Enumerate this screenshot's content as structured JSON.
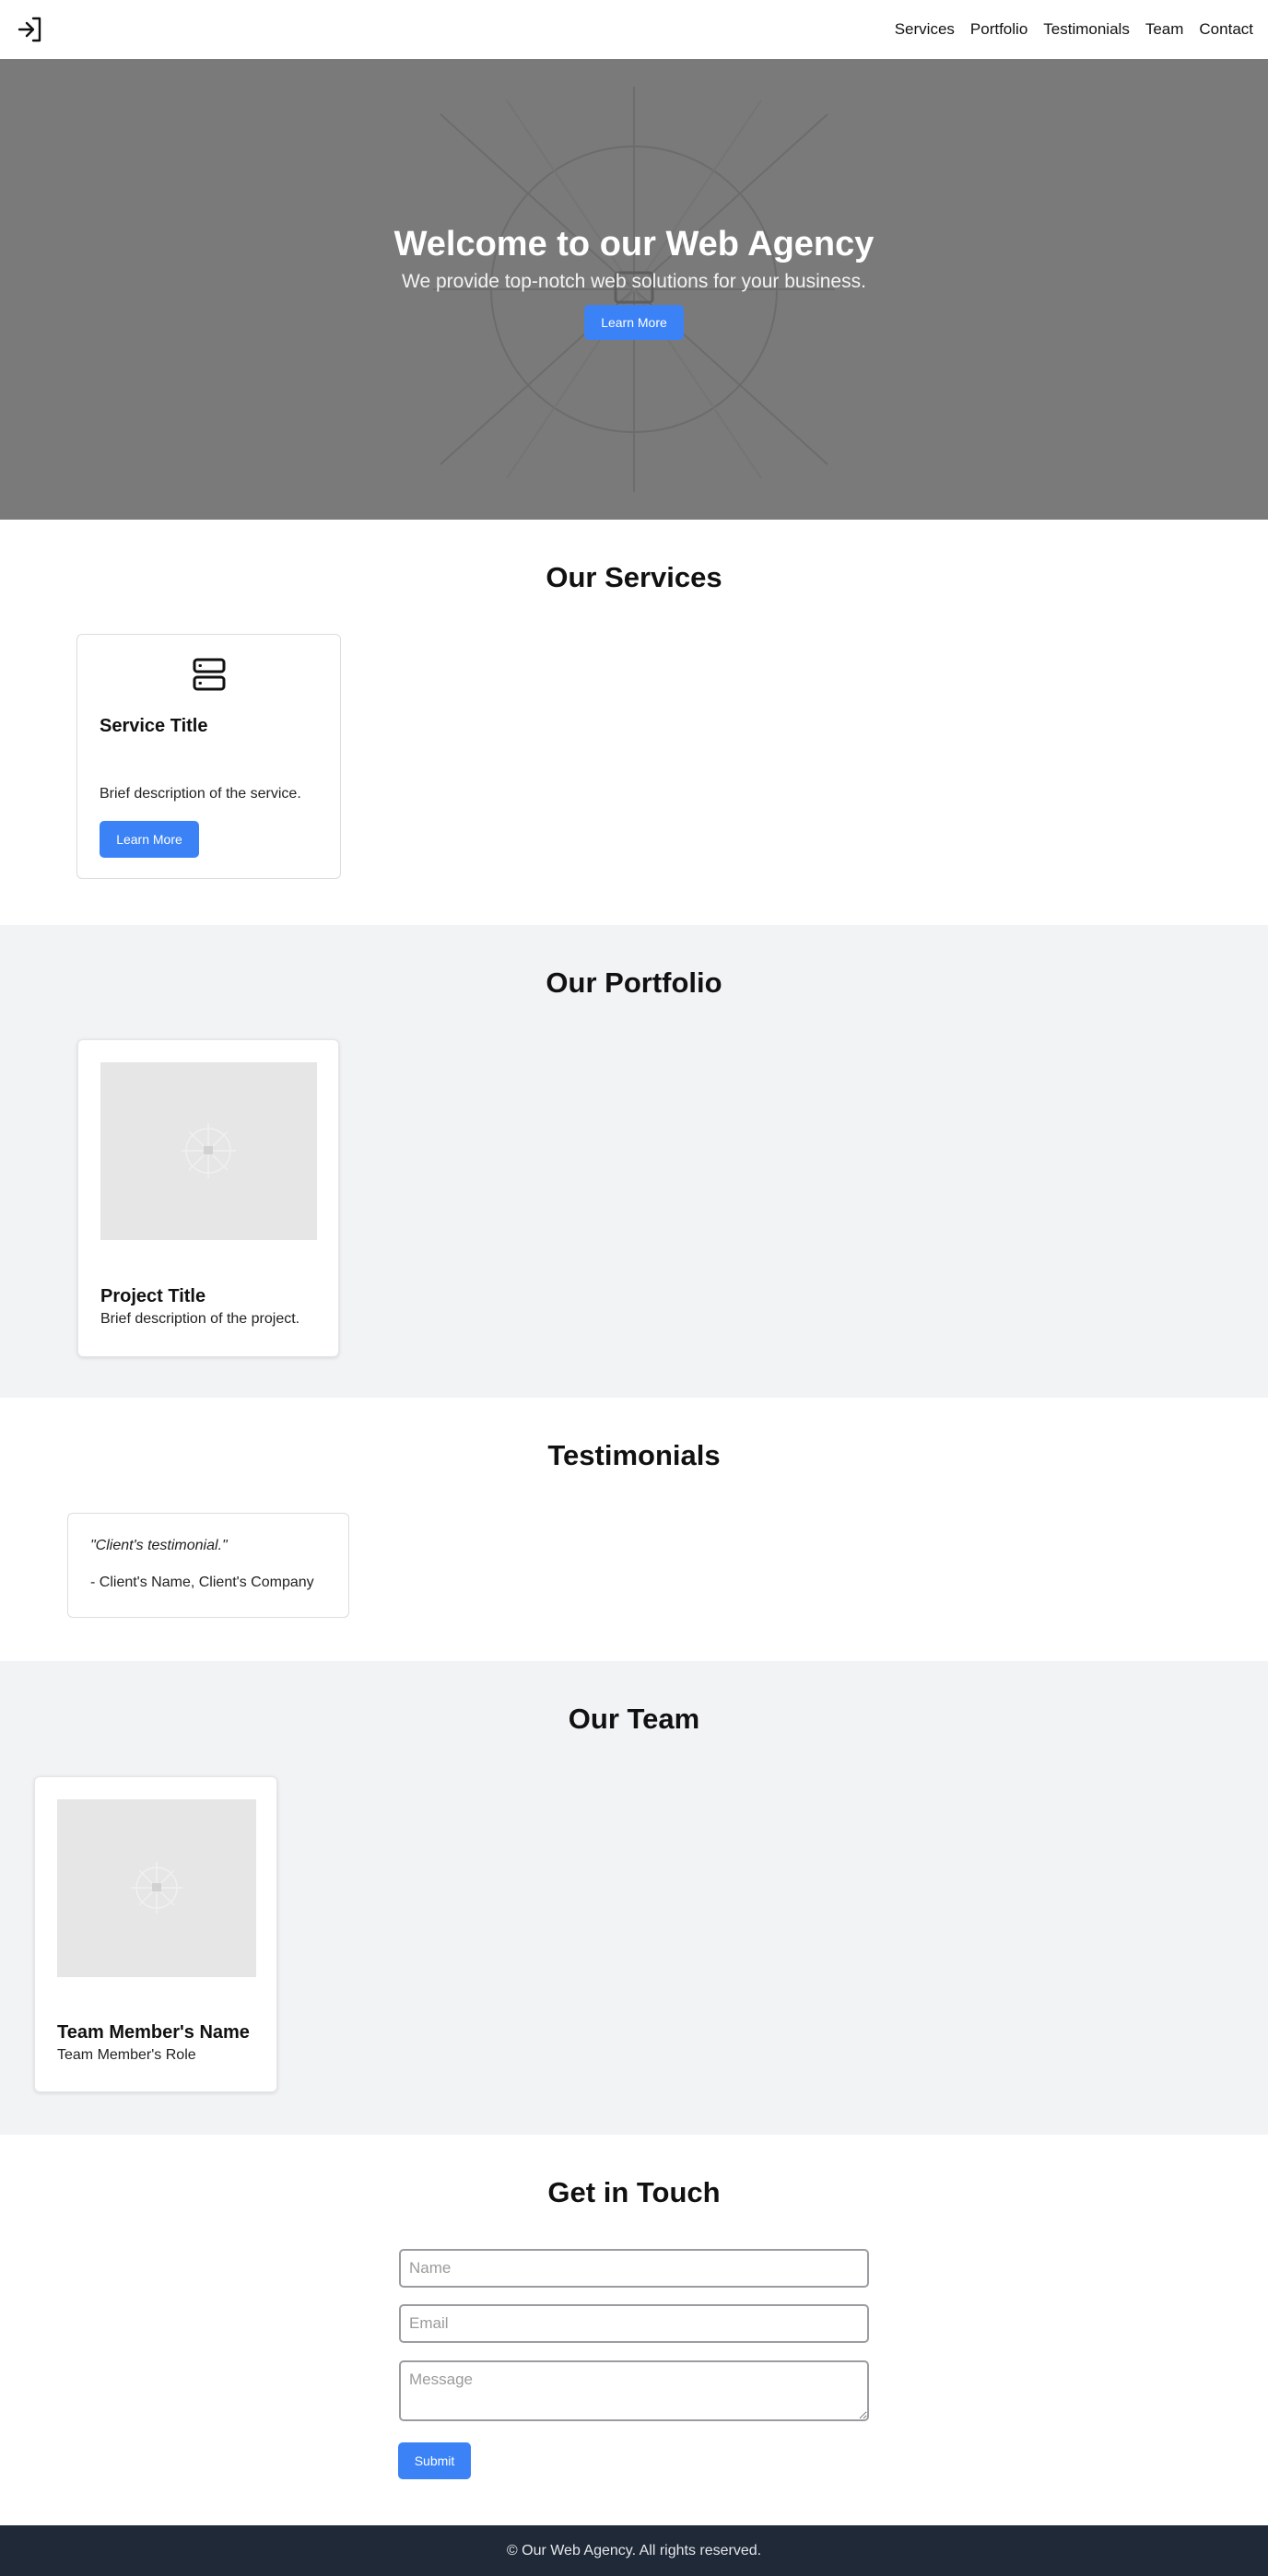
{
  "nav": {
    "logo_icon": "sign-in-icon",
    "items": [
      {
        "label": "Services"
      },
      {
        "label": "Portfolio"
      },
      {
        "label": "Testimonials"
      },
      {
        "label": "Team"
      },
      {
        "label": "Contact"
      }
    ]
  },
  "hero": {
    "title": "Welcome to our Web Agency",
    "subtitle": "We provide top-notch web solutions for your business.",
    "button_label": "Learn More"
  },
  "services": {
    "title": "Our Services",
    "cards": [
      {
        "icon": "server-icon",
        "title": "Service Title",
        "description": "Brief description of the service.",
        "button_label": "Learn More"
      }
    ]
  },
  "portfolio": {
    "title": "Our Portfolio",
    "cards": [
      {
        "title": "Project Title",
        "description": "Brief description of the project."
      }
    ]
  },
  "testimonials": {
    "title": "Testimonials",
    "items": [
      {
        "quote": "\"Client's testimonial.\"",
        "author": "- Client's Name, Client's Company"
      }
    ]
  },
  "team": {
    "title": "Our Team",
    "members": [
      {
        "name": "Team Member's Name",
        "role": "Team Member's Role"
      }
    ]
  },
  "contact": {
    "title": "Get in Touch",
    "name_placeholder": "Name",
    "email_placeholder": "Email",
    "message_placeholder": "Message",
    "submit_label": "Submit"
  },
  "footer": {
    "text": "© Our Web Agency. All rights reserved."
  },
  "colors": {
    "accent": "#3b82f6",
    "hero_bg": "#7a7a7a",
    "section_alt_bg": "#f2f3f5",
    "footer_bg": "#1f2937"
  }
}
